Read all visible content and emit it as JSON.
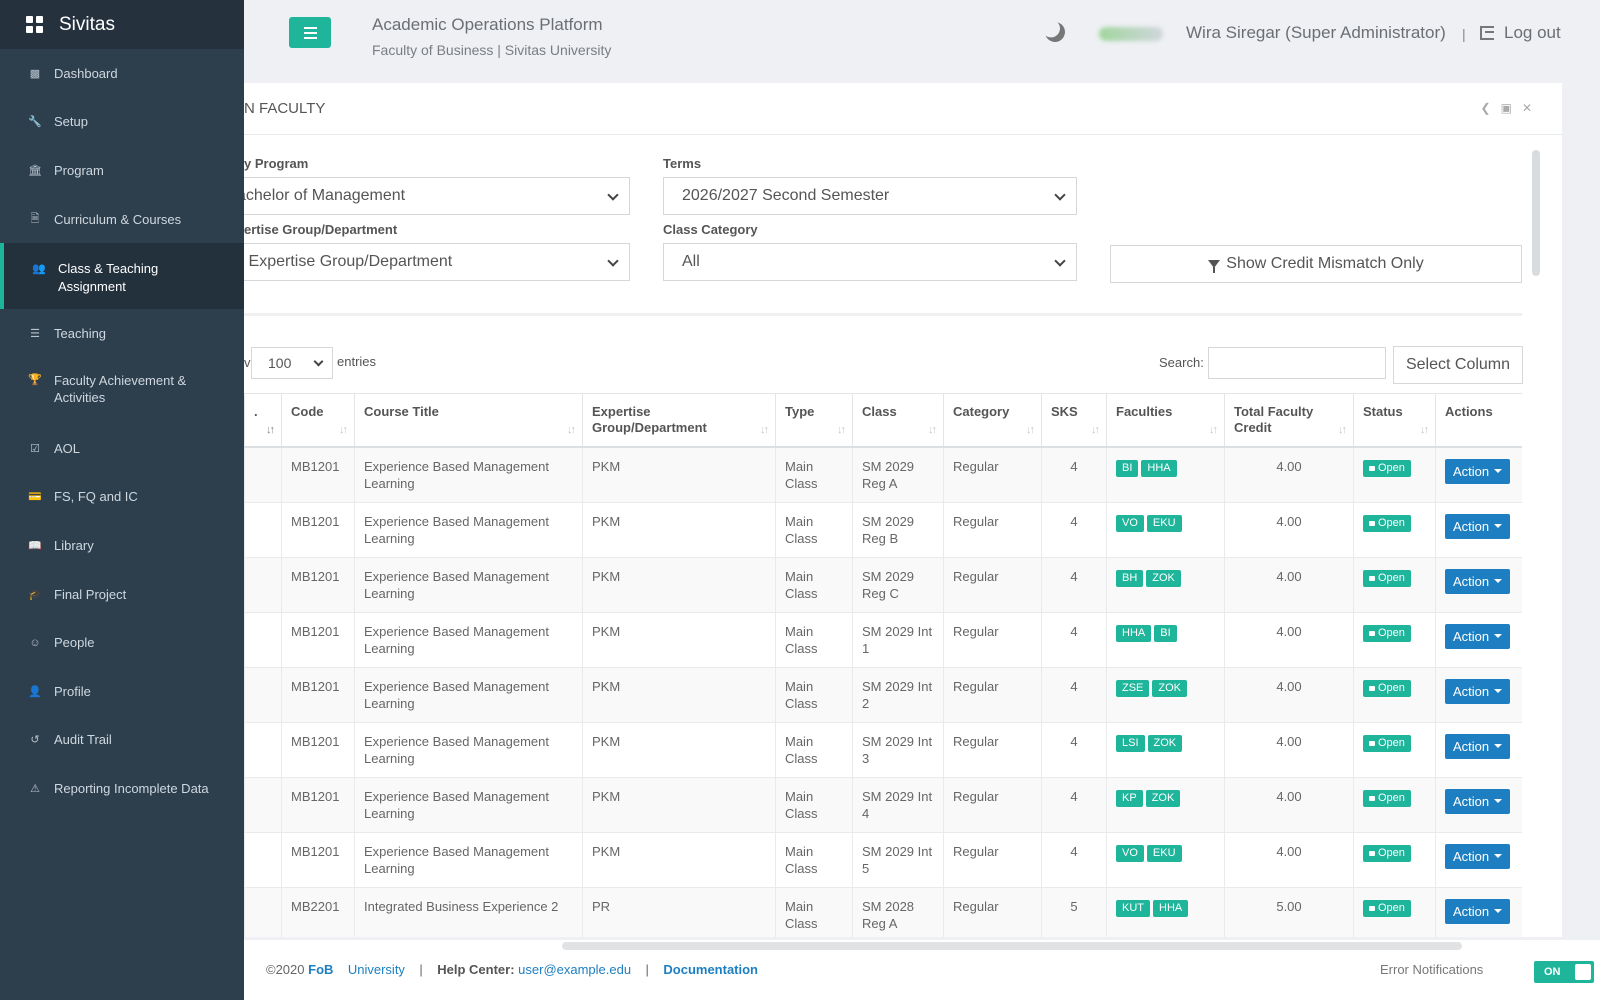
{
  "brand": {
    "name": "Sivitas"
  },
  "sidebar": {
    "items": [
      {
        "label": "Dashboard",
        "icon": "bar-chart-icon"
      },
      {
        "label": "Setup",
        "icon": "wrench-icon"
      },
      {
        "label": "Program",
        "icon": "bank-icon"
      },
      {
        "label": "Curriculum & Courses",
        "icon": "document-icon"
      },
      {
        "label": "Class & Teaching Assignment",
        "icon": "users-icon",
        "active": true
      },
      {
        "label": "Teaching",
        "icon": "list-icon"
      },
      {
        "label": "Faculty Achievement & Activities",
        "icon": "trophy-icon"
      },
      {
        "label": "AOL",
        "icon": "check-square-icon"
      },
      {
        "label": "FS, FQ and IC",
        "icon": "id-card-icon"
      },
      {
        "label": "Library",
        "icon": "book-icon"
      },
      {
        "label": "Final Project",
        "icon": "graduation-cap-icon"
      },
      {
        "label": "People",
        "icon": "user-circle-icon"
      },
      {
        "label": "Profile",
        "icon": "user-icon"
      },
      {
        "label": "Audit Trail",
        "icon": "history-icon"
      },
      {
        "label": "Reporting Incomplete Data",
        "icon": "warning-icon"
      }
    ]
  },
  "header": {
    "title": "Academic Operations Platform",
    "subtitle": "Faculty of Business | Sivitas University",
    "user": "Wira Siregar (Super Administrator)",
    "separator": "|",
    "logout": "Log out"
  },
  "panel": {
    "title": "N FACULTY",
    "filters": {
      "program_label": "y Program",
      "program_value": "achelor of Management",
      "terms_label": "Terms",
      "terms_value": "2026/2027 Second Semester",
      "expertise_label": "ertise Group/Department",
      "expertise_value": "ll Expertise Group/Department",
      "category_label": "Class Category",
      "category_value": "All",
      "credit_button": "Show Credit Mismatch Only"
    },
    "table_controls": {
      "show_fragment": "v",
      "length_value": "100",
      "entries_label": "entries",
      "search_label": "Search:",
      "search_value": "",
      "select_column": "Select Column"
    }
  },
  "table": {
    "columns": [
      ".",
      "Code",
      "Course Title",
      "Expertise Group/Department",
      "Type",
      "Class",
      "Category",
      "SKS",
      "Faculties",
      "Total Faculty Credit",
      "Status",
      "Actions"
    ],
    "rows": [
      {
        "code": "MB1201",
        "title": "Experience Based Management Learning",
        "group": "PKM",
        "type": "Main Class",
        "class": "SM 2029 Reg A",
        "category": "Regular",
        "sks": "4",
        "faculties": [
          "BI",
          "HHA"
        ],
        "credit": "4.00",
        "status": "Open",
        "action": "Action"
      },
      {
        "code": "MB1201",
        "title": "Experience Based Management Learning",
        "group": "PKM",
        "type": "Main Class",
        "class": "SM 2029 Reg B",
        "category": "Regular",
        "sks": "4",
        "faculties": [
          "VO",
          "EKU"
        ],
        "credit": "4.00",
        "status": "Open",
        "action": "Action"
      },
      {
        "code": "MB1201",
        "title": "Experience Based Management Learning",
        "group": "PKM",
        "type": "Main Class",
        "class": "SM 2029 Reg C",
        "category": "Regular",
        "sks": "4",
        "faculties": [
          "BH",
          "ZOK"
        ],
        "credit": "4.00",
        "status": "Open",
        "action": "Action"
      },
      {
        "code": "MB1201",
        "title": "Experience Based Management Learning",
        "group": "PKM",
        "type": "Main Class",
        "class": "SM 2029 Int 1",
        "category": "Regular",
        "sks": "4",
        "faculties": [
          "HHA",
          "BI"
        ],
        "credit": "4.00",
        "status": "Open",
        "action": "Action"
      },
      {
        "code": "MB1201",
        "title": "Experience Based Management Learning",
        "group": "PKM",
        "type": "Main Class",
        "class": "SM 2029 Int 2",
        "category": "Regular",
        "sks": "4",
        "faculties": [
          "ZSE",
          "ZOK"
        ],
        "credit": "4.00",
        "status": "Open",
        "action": "Action"
      },
      {
        "code": "MB1201",
        "title": "Experience Based Management Learning",
        "group": "PKM",
        "type": "Main Class",
        "class": "SM 2029 Int 3",
        "category": "Regular",
        "sks": "4",
        "faculties": [
          "LSI",
          "ZOK"
        ],
        "credit": "4.00",
        "status": "Open",
        "action": "Action"
      },
      {
        "code": "MB1201",
        "title": "Experience Based Management Learning",
        "group": "PKM",
        "type": "Main Class",
        "class": "SM 2029 Int 4",
        "category": "Regular",
        "sks": "4",
        "faculties": [
          "KP",
          "ZOK"
        ],
        "credit": "4.00",
        "status": "Open",
        "action": "Action"
      },
      {
        "code": "MB1201",
        "title": "Experience Based Management Learning",
        "group": "PKM",
        "type": "Main Class",
        "class": "SM 2029 Int 5",
        "category": "Regular",
        "sks": "4",
        "faculties": [
          "VO",
          "EKU"
        ],
        "credit": "4.00",
        "status": "Open",
        "action": "Action"
      },
      {
        "code": "MB2201",
        "title": "Integrated Business Experience 2",
        "group": "PR",
        "type": "Main Class",
        "class": "SM 2028 Reg A",
        "category": "Regular",
        "sks": "5",
        "faculties": [
          "KUT",
          "HHA"
        ],
        "credit": "5.00",
        "status": "Open",
        "action": "Action"
      }
    ]
  },
  "footer": {
    "copyright": "©2020",
    "fob": "FoB",
    "university": "University",
    "sep1": "|",
    "help_label": "Help Center:",
    "help_email": "user@example.edu",
    "sep2": "|",
    "docs": "Documentation",
    "error_label": "Error Notifications",
    "toggle": "ON"
  },
  "colors": {
    "accent": "#1fb59a",
    "sidebar": "#2d3e4d",
    "primary_button": "#1d7fc1"
  }
}
